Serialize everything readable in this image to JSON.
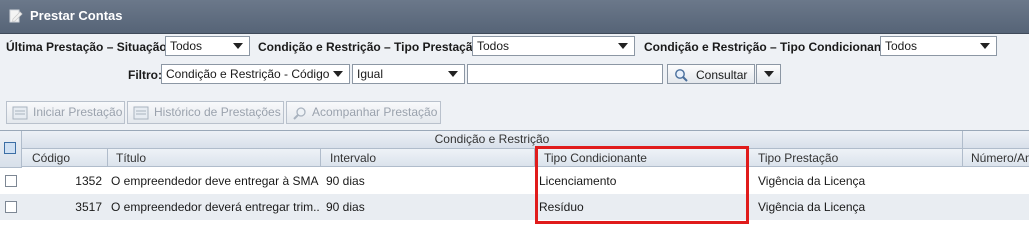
{
  "window": {
    "title": "Prestar Contas"
  },
  "filters": {
    "ultima_label": "Última Prestação – Situação:",
    "ultima_value": "Todos",
    "cond_tipo_prest_label": "Condição e Restrição – Tipo Prestação:",
    "cond_tipo_prest_value": "Todos",
    "cond_tipo_cond_label": "Condição e Restrição – Tipo Condicionante:",
    "cond_tipo_cond_value": "Todos",
    "filtro_label": "Filtro:",
    "filtro_field_value": "Condição e Restrição - Código",
    "filtro_operator_value": "Igual",
    "filtro_text_value": "",
    "consultar_label": "Consultar"
  },
  "toolbar": {
    "iniciar_label": "Iniciar Prestação",
    "historico_label": "Histórico de Prestações",
    "acompanhar_label": "Acompanhar Prestação"
  },
  "grid": {
    "group_header": "Condição e Restrição",
    "columns": {
      "codigo": "Código",
      "titulo": "Título",
      "intervalo": "Intervalo",
      "tipo_condicionante": "Tipo Condicionante",
      "tipo_prestacao": "Tipo Prestação",
      "numero": "Número/An"
    },
    "rows": [
      {
        "codigo": "1352",
        "titulo": "O empreendedor deve entregar à SMA...",
        "intervalo": "90 dias",
        "tipo_condicionante": "Licenciamento",
        "tipo_prestacao": "Vigência da Licença"
      },
      {
        "codigo": "3517",
        "titulo": "O empreendedor deverá entregar trim...",
        "intervalo": "90 dias",
        "tipo_condicionante": "Resíduo",
        "tipo_prestacao": "Vigência da Licença"
      }
    ]
  },
  "colors": {
    "highlight": "#e01b1b",
    "titlebar": "#5f6c7f"
  }
}
